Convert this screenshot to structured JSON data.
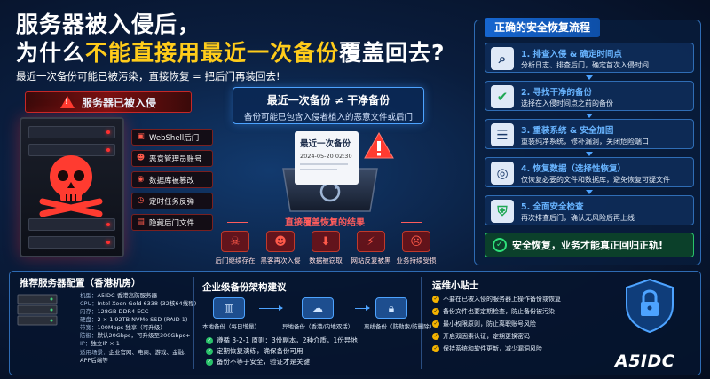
{
  "header": {
    "title_line1": "服务器被入侵后，",
    "title_line2_pre": "为什么",
    "title_line2_hl": "不能直接用最近一次备份",
    "title_line2_post": "覆盖回去?",
    "subtitle": "最近一次备份可能已被污染，直接恢复 = 把后门再装回去!"
  },
  "left": {
    "banner": "服务器已被入侵",
    "threats": [
      "WebShell后门",
      "恶意管理员账号",
      "数据库被篡改",
      "定时任务反弹",
      "隐藏后门文件"
    ]
  },
  "middle": {
    "box_line1": "最近一次备份 ≠ 干净备份",
    "box_line2": "备份可能已包含入侵者植入的恶意文件或后门",
    "doc_title": "最近一次备份",
    "doc_date": "2024-05-20 02:30",
    "result_title": "直接覆盖恢复的结果",
    "results": [
      "后门继续存在",
      "黑客再次入侵",
      "数据被窃取",
      "网站反复被黑",
      "业务持续受损"
    ]
  },
  "flow": {
    "title": "正确的安全恢复流程",
    "steps": [
      {
        "title": "1. 排查入侵 & 确定时间点",
        "desc": "分析日志、排查后门，确定首次入侵时间"
      },
      {
        "title": "2. 寻找干净的备份",
        "desc": "选择在入侵时间点之前的备份"
      },
      {
        "title": "3. 重装系统 & 安全加固",
        "desc": "重装纯净系统，修补漏洞，关闭危险端口"
      },
      {
        "title": "4. 恢复数据（选择性恢复）",
        "desc": "仅恢复必要的文件和数据库，避免恢复可疑文件"
      },
      {
        "title": "5. 全面安全检查",
        "desc": "再次排查后门，确认无风险后再上线"
      }
    ],
    "final": "安全恢复，业务才能真正回归正轨!"
  },
  "bottom": {
    "config_title": "推荐服务器配置（香港机房）",
    "specs": [
      {
        "k": "机型：",
        "v": "A5IDC 香港高防服务器"
      },
      {
        "k": "CPU：",
        "v": "Intel Xeon Gold 6338 (32核64线程)"
      },
      {
        "k": "内存：",
        "v": "128GB DDR4 ECC"
      },
      {
        "k": "硬盘：",
        "v": "2 × 1.92TB NVMe SSD (RAID 1)"
      },
      {
        "k": "带宽：",
        "v": "100Mbps 独享（可升级）"
      },
      {
        "k": "防御：",
        "v": "默认20Gbps，可升级至300Gbps+"
      },
      {
        "k": "IP：",
        "v": "独立IP × 1"
      },
      {
        "k": "适用场景：",
        "v": "企业官网、电商、游戏、金融、"
      },
      {
        "k": "",
        "v": "APP后端等"
      }
    ],
    "arch_title": "企业级备份架构建议",
    "arch_nodes": [
      "本地备份（每日增量）",
      "异地备份（香港/内地双活）",
      "离线备份（防勒索/防删除）"
    ],
    "arch_bullets": [
      "遵循 3-2-1 原则：3份副本，2种介质，1份异地",
      "定期恢复演练，确保备份可用",
      "备份不等于安全，验证才是关键"
    ],
    "tips_title": "运维小贴士",
    "tips": [
      "不要在已被入侵的服务器上操作备份或恢复",
      "备份文件也要定期检查，防止备份被污染",
      "最小权限原则，防止离职账号风险",
      "开启双因素认证，定期更换密码",
      "保持系统和软件更新，减少漏洞风险"
    ],
    "brand": "A5IDC"
  },
  "colors": {
    "accent": "#ffcc1a",
    "danger": "#ff3b30",
    "primary": "#4da3ff",
    "success": "#29c26a"
  }
}
